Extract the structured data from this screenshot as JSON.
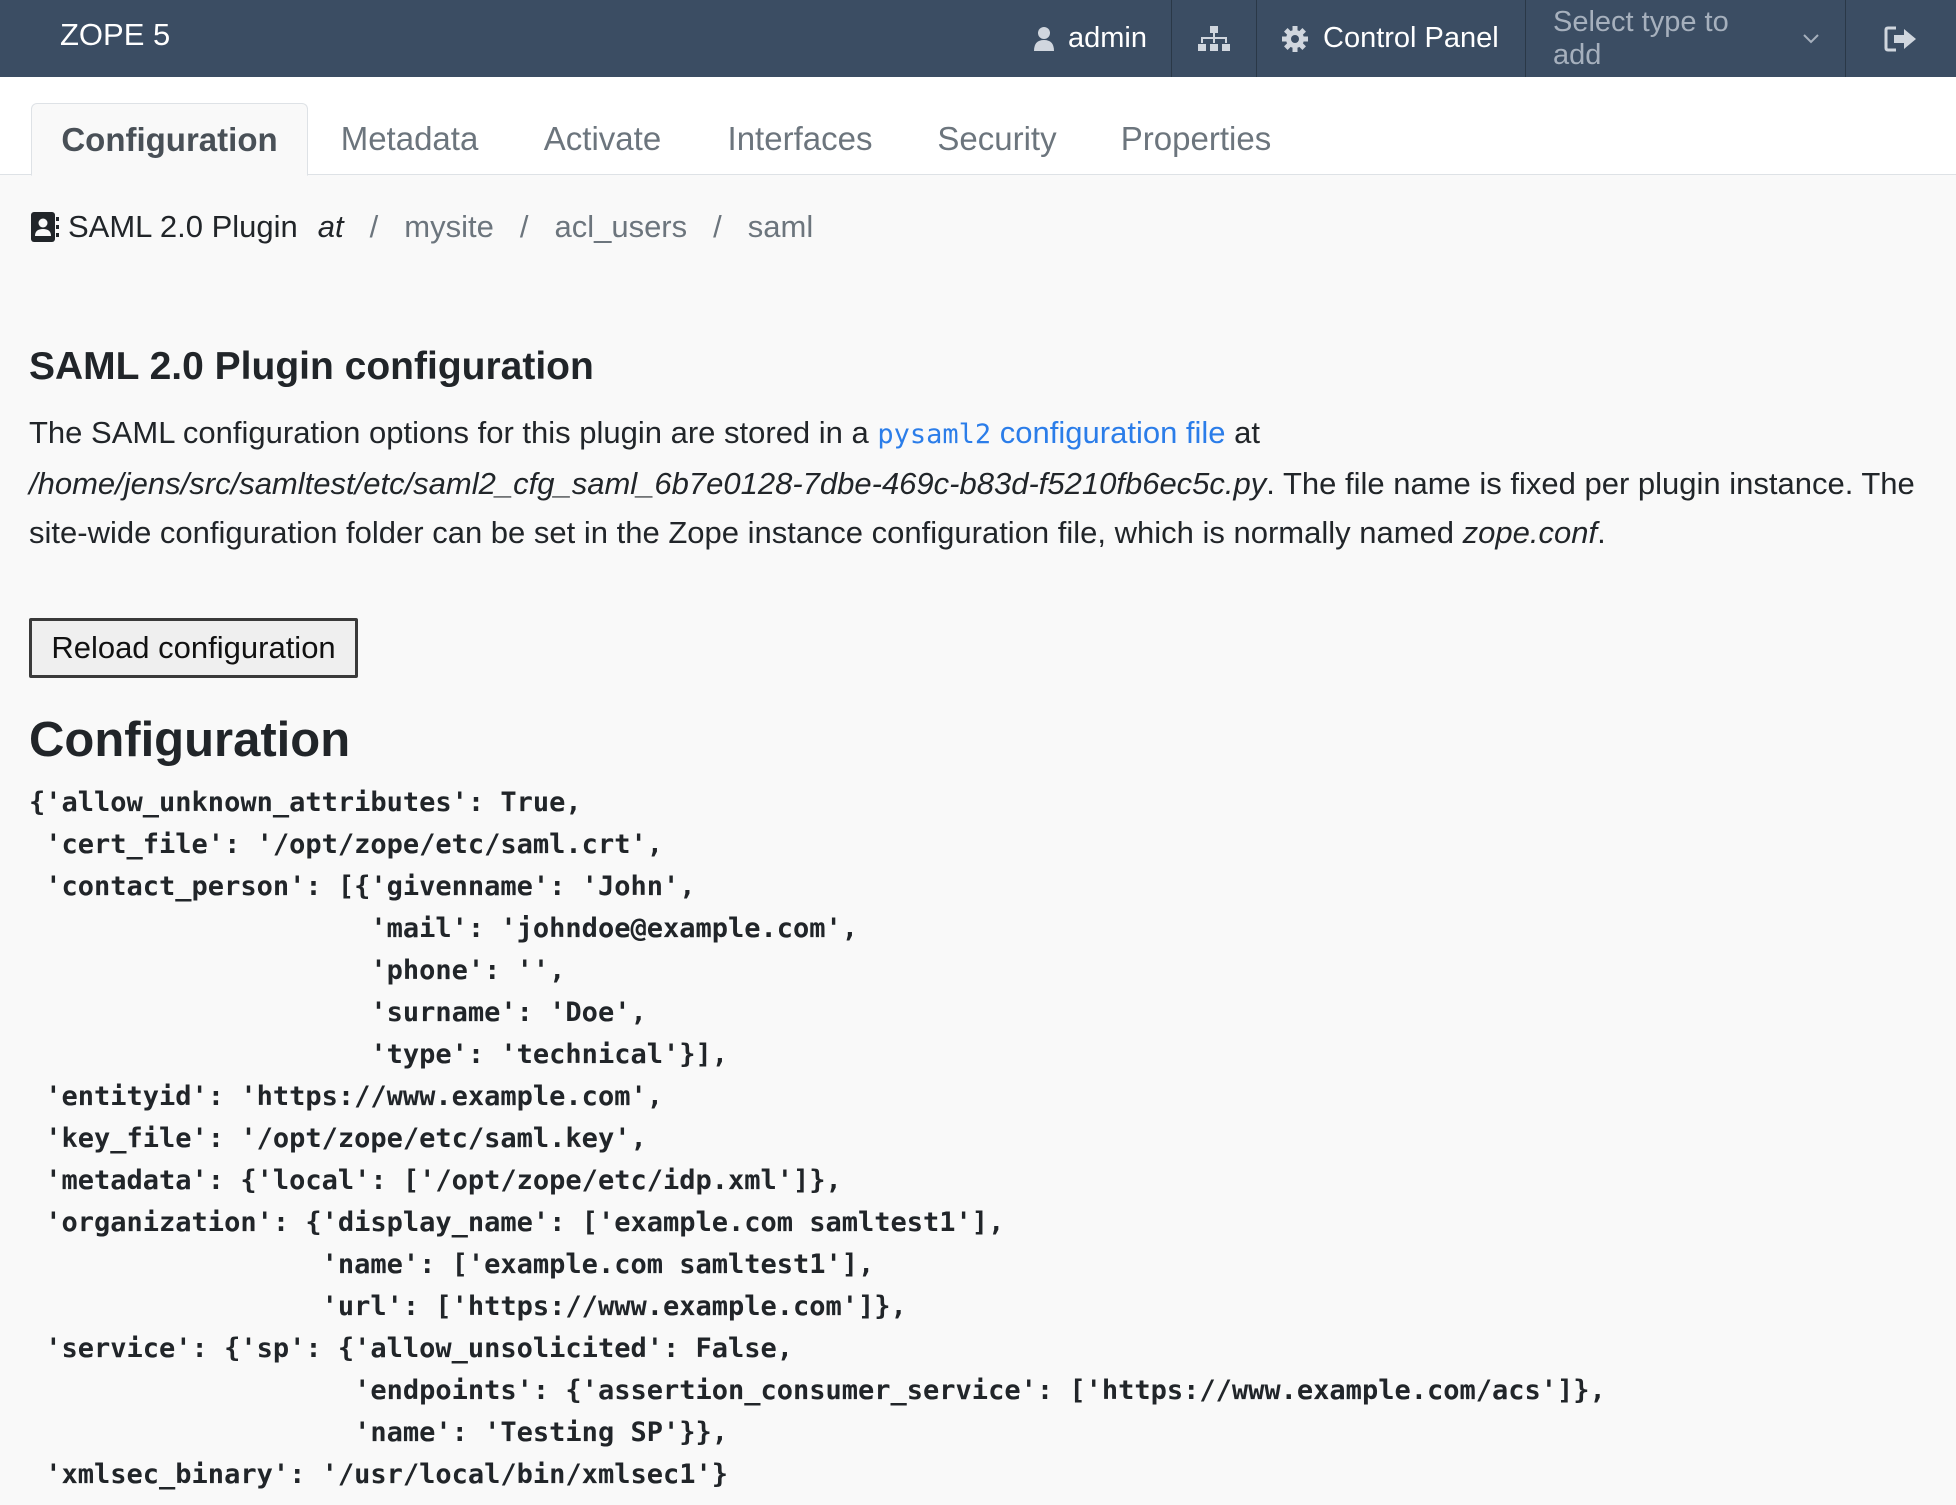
{
  "navbar": {
    "brand": "ZOPE 5",
    "user": "admin",
    "control_panel": "Control Panel",
    "select_type_placeholder": "Select type to add"
  },
  "tabs": [
    {
      "label": "Configuration",
      "active": true
    },
    {
      "label": "Metadata",
      "active": false
    },
    {
      "label": "Activate",
      "active": false
    },
    {
      "label": "Interfaces",
      "active": false
    },
    {
      "label": "Security",
      "active": false
    },
    {
      "label": "Properties",
      "active": false
    }
  ],
  "breadcrumb": {
    "object_type": "SAML 2.0 Plugin",
    "at": "at",
    "separator": "/",
    "crumbs": [
      "mysite",
      "acl_users",
      "saml"
    ]
  },
  "main": {
    "heading": "SAML 2.0 Plugin configuration",
    "intro": {
      "text_before": "The SAML configuration options for this plugin are stored in a ",
      "link_code": "pysaml2",
      "link_text": " configuration file",
      "text_at": " at",
      "path": "/home/jens/src/samltest/etc/saml2_cfg_saml_6b7e0128-7dbe-469c-b83d-f5210fb6ec5c.py",
      "text_after": ". The file name is fixed per plugin instance. The site-wide configuration folder can be set in the Zope instance configuration file, which is normally named ",
      "conf_name": "zope.conf",
      "end": "."
    },
    "reload_button": "Reload configuration",
    "config_heading": "Configuration",
    "config_lines": [
      "{'allow_unknown_attributes': True,",
      " 'cert_file': '/opt/zope/etc/saml.crt',",
      " 'contact_person': [{'givenname': 'John',",
      "                     'mail': 'johndoe@example.com',",
      "                     'phone': '',",
      "                     'surname': 'Doe',",
      "                     'type': 'technical'}],",
      " 'entityid': 'https://www.example.com',",
      " 'key_file': '/opt/zope/etc/saml.key',",
      " 'metadata': {'local': ['/opt/zope/etc/idp.xml']},",
      " 'organization': {'display_name': ['example.com samltest1'],",
      "                  'name': ['example.com samltest1'],",
      "                  'url': ['https://www.example.com']},",
      " 'service': {'sp': {'allow_unsolicited': False,",
      "                    'endpoints': {'assertion_consumer_service': ['https://www.example.com/acs']},",
      "                    'name': 'Testing SP'}},",
      " 'xmlsec_binary': '/usr/local/bin/xmlsec1'}"
    ]
  },
  "colors": {
    "navbar_bg": "#3b4d63",
    "link": "#2b7de9",
    "page_bg": "#f9f9f9"
  },
  "icons": {
    "user": "user-icon",
    "sitemap": "sitemap-icon",
    "control_panel": "gear-icon",
    "select": "chevron-down-icon",
    "logout": "logout-icon",
    "plugin": "address-card-icon"
  }
}
